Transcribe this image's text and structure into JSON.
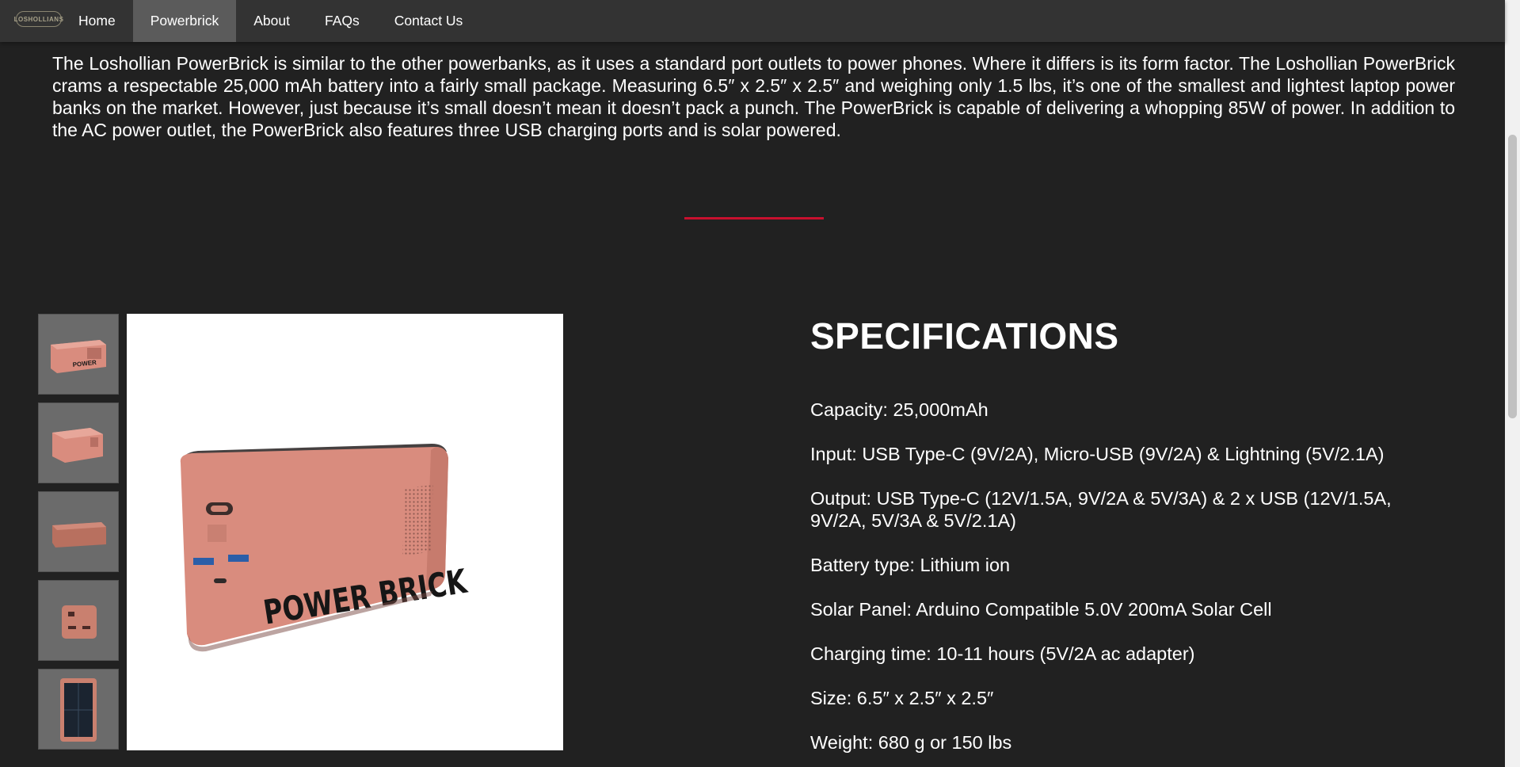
{
  "brand": {
    "logo_text": "LOSHOLLIANS"
  },
  "nav": {
    "items": [
      {
        "label": "Home"
      },
      {
        "label": "Powerbrick"
      },
      {
        "label": "About"
      },
      {
        "label": "FAQs"
      },
      {
        "label": "Contact Us"
      }
    ],
    "active_index": 1
  },
  "intro": {
    "text": "The Loshollian PowerBrick is similar to the other powerbanks, as it uses a standard port outlets to power phones. Where it differs is its form factor. The Loshollian PowerBrick crams a respectable 25,000 mAh battery into a fairly small package. Measuring 6.5″ x 2.5″ x 2.5″ and weighing only 1.5 lbs, it’s one of the smallest and lightest laptop power banks on the market. However, just because it’s small doesn’t mean it doesn’t pack a punch. The PowerBrick is capable of delivering a whopping 85W of power. In addition to the AC power outlet, the PowerBrick also features three USB charging ports and is solar powered."
  },
  "product": {
    "image_label": "POWER BRICK",
    "thumbnails": [
      {
        "view": "front-angle"
      },
      {
        "view": "side-angle"
      },
      {
        "view": "back"
      },
      {
        "view": "end"
      },
      {
        "view": "solar-panel"
      }
    ]
  },
  "specs": {
    "title": "SPECIFICATIONS",
    "items": [
      "Capacity: 25,000mAh",
      "Input: USB Type-C (9V/2A), Micro-USB (9V/2A) & Lightning (5V/2.1A)",
      "Output: USB Type-C (12V/1.5A, 9V/2A & 5V/3A) & 2 x USB (12V/1.5A, 9V/2A, 5V/3A & 5V/2.1A)",
      "Battery type: Lithium ion",
      "Solar Panel: Arduino Compatible 5.0V 200mA Solar Cell",
      "Charging time: 10-11 hours (5V/2A ac adapter)",
      "Size: 6.5″ x 2.5″ x 2.5″",
      "Weight: 680 g or 150 lbs"
    ]
  },
  "colors": {
    "background": "#212121",
    "navbar": "#333333",
    "nav_active": "#5b5b5b",
    "accent": "#c8102e",
    "product_body": "#d98c7e"
  }
}
